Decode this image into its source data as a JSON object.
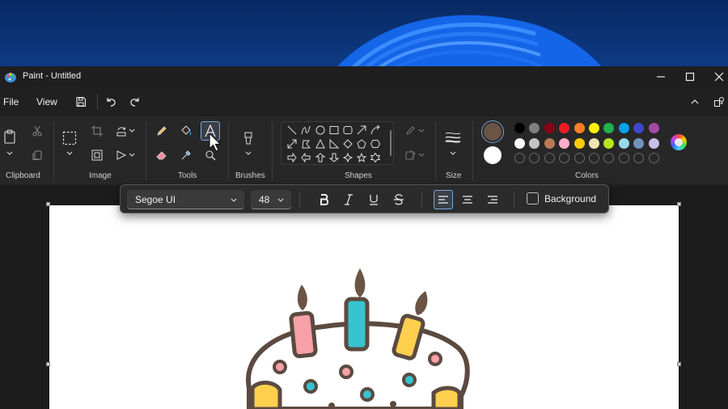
{
  "window": {
    "title": "Paint - Untitled",
    "controls": [
      "minimize",
      "maximize",
      "close"
    ]
  },
  "menubar": {
    "file_label": "File",
    "view_label": "View",
    "icons": [
      "save-icon",
      "undo-icon",
      "redo-icon",
      "collapse-ribbon-icon",
      "share-icon"
    ]
  },
  "ribbon": {
    "groups": {
      "clipboard": "Clipboard",
      "image": "Image",
      "tools": "Tools",
      "brushes": "Brushes",
      "shapes": "Shapes",
      "size": "Size",
      "colors": "Colors"
    },
    "selected_tool": "text-tool",
    "colors": {
      "color1": "#6b5445",
      "color2": "#ffffff",
      "palette_row1": [
        "#000000",
        "#7f7f7f",
        "#880015",
        "#ed1c24",
        "#ff7f27",
        "#fff200",
        "#22b14c",
        "#00a2e8",
        "#3f48cc",
        "#a349a4"
      ],
      "palette_row2": [
        "#ffffff",
        "#c3c3c3",
        "#b97a57",
        "#ffaec9",
        "#ffc90e",
        "#efe4b0",
        "#b5e61d",
        "#99d9ea",
        "#7092be",
        "#c8bfe7"
      ],
      "palette_row3_empty_count": 10
    }
  },
  "text_toolbar": {
    "font_family": "Segoe UI",
    "font_size": "48",
    "format_buttons": [
      "bold",
      "italic",
      "underline",
      "strikethrough"
    ],
    "alignment": [
      "align-left",
      "align-center",
      "align-right"
    ],
    "active_alignment": "align-left",
    "background_label": "Background",
    "background_checked": false
  }
}
